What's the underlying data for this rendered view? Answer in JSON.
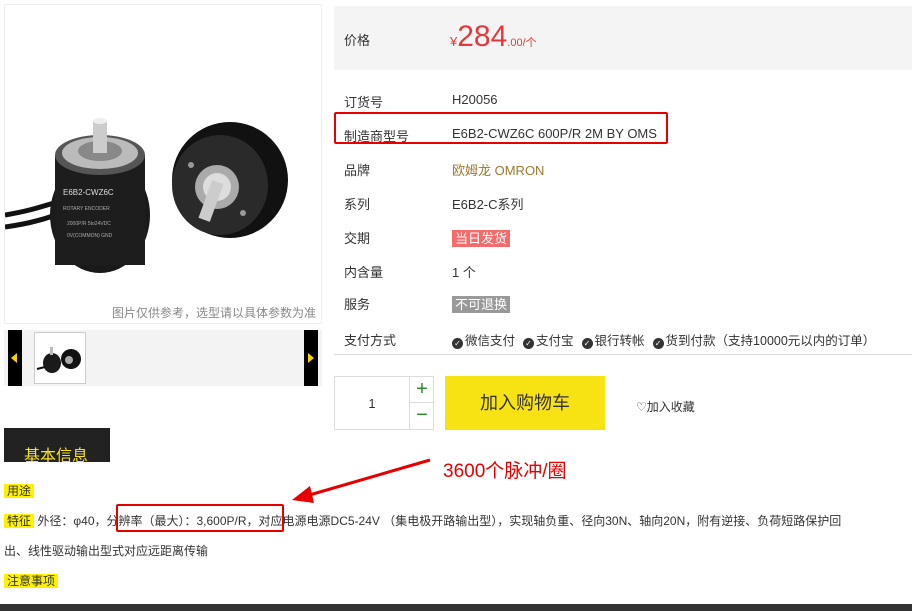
{
  "image": {
    "caption": "图片仅供参考，选型请以具体参数为准"
  },
  "price": {
    "label": "价格",
    "currency": "¥",
    "integer": "284",
    "decimal": ".00/个"
  },
  "attributes": [
    {
      "key": "订货号",
      "value": "H20056"
    },
    {
      "key": "制造商型号",
      "value": "E6B2-CWZ6C 600P/R 2M BY OMS"
    },
    {
      "key": "品牌",
      "value": "欧姆龙 OMRON"
    },
    {
      "key": "系列",
      "value": "E6B2-C系列"
    },
    {
      "key": "交期",
      "value": "当日发货"
    },
    {
      "key": "内含量",
      "value": "1 个"
    },
    {
      "key": "服务",
      "value": "不可退换"
    },
    {
      "key": "支付方式",
      "value": ""
    }
  ],
  "payment": {
    "items": [
      "微信支付",
      "支付宝",
      "银行转帐",
      "货到付款（支持10000元以内的订单）"
    ]
  },
  "cart": {
    "qty": "1",
    "plus": "+",
    "minus": "−",
    "add_label": "加入购物车",
    "fav_label": "♡加入收藏"
  },
  "basic_info": {
    "tab": "基本信息",
    "usage_label": "用途",
    "feature_label": "特征",
    "feature_pre": "外径：φ40，",
    "feature_highlight": "分辨率（最大）：3,600P/R，",
    "feature_post": "对应电源电源DC5-24V （集电极开路输出型），实现轴负重、径向30N、轴向20N，附有逆接、负荷短路保护回",
    "feature_line2": "出、线性驱动输出型式对应远距离传输",
    "notes_label": "注意事项"
  },
  "annotation": {
    "text": "3600个脉冲/圈",
    "color": "#e60000"
  },
  "colors": {
    "price": "#e4393c",
    "cart_button": "#f7e214",
    "highlight": "#fff100",
    "brand": "#9c7a2e"
  }
}
